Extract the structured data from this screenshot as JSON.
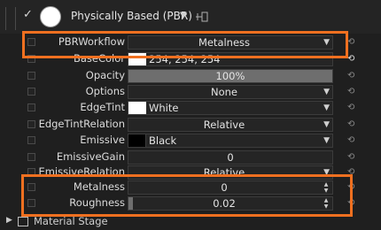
{
  "header": {
    "title": "Physically Based (PBR)",
    "enabled_glyph": "✓",
    "material_color": "#ffffff"
  },
  "rows": {
    "pbrworkflow": {
      "label": "PBRWorkflow",
      "value": "Metalness"
    },
    "basecolor": {
      "label": "BaseColor",
      "value": "254, 254, 254",
      "color": "#fefefe"
    },
    "opacity": {
      "label": "Opacity",
      "value": "100%",
      "level": 1.0
    },
    "options": {
      "label": "Options",
      "value": "None"
    },
    "edgetint": {
      "label": "EdgeTint",
      "value": "White",
      "color": "#ffffff"
    },
    "edgetintrelation": {
      "label": "EdgeTintRelation",
      "value": "Relative"
    },
    "emissive": {
      "label": "Emissive",
      "value": "Black",
      "color": "#000000"
    },
    "emissivegain": {
      "label": "EmissiveGain",
      "value": "0",
      "level": 0.0
    },
    "emissiverelation": {
      "label": "EmissiveRelation",
      "value": "Relative"
    },
    "metalness": {
      "label": "Metalness",
      "value": "0"
    },
    "roughness": {
      "label": "Roughness",
      "value": "0.02",
      "level": 0.02
    }
  },
  "footer": {
    "stage_label": "Material Stage"
  },
  "colors": {
    "highlight": "#f07020",
    "fill": "#6e6e6e"
  }
}
